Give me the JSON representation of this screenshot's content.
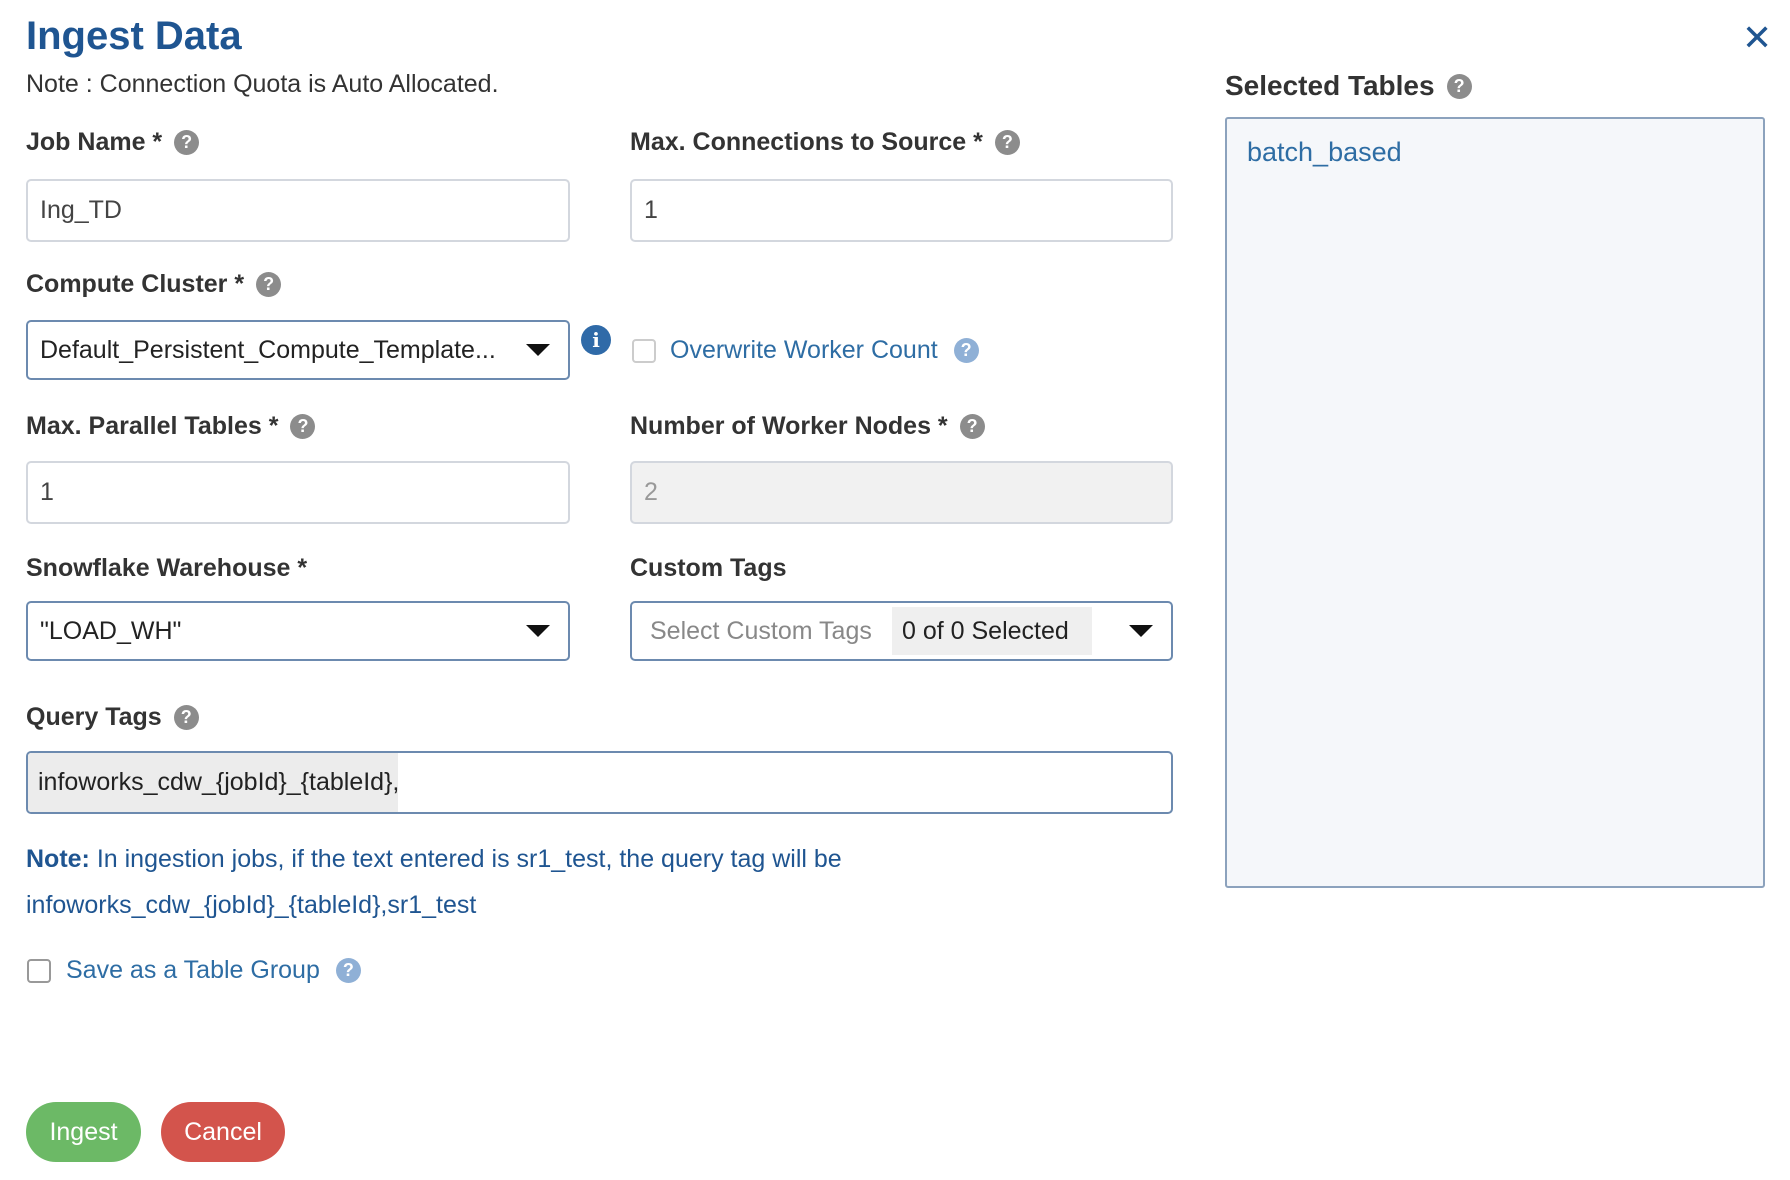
{
  "dialog": {
    "title": "Ingest Data",
    "note_quota": "Note : Connection Quota is Auto Allocated.",
    "close_symbol": "✕"
  },
  "form": {
    "job_name": {
      "label": "Job Name *",
      "value": "Ing_TD"
    },
    "max_connections": {
      "label": "Max. Connections to Source *",
      "value": "1"
    },
    "compute_cluster": {
      "label": "Compute Cluster *",
      "value": "Default_Persistent_Compute_Template..."
    },
    "overwrite_worker_count": {
      "label": "Overwrite Worker Count",
      "checked": false
    },
    "max_parallel_tables": {
      "label": "Max. Parallel Tables *",
      "value": "1"
    },
    "worker_nodes": {
      "label": "Number of Worker Nodes *",
      "value": "2",
      "disabled": true
    },
    "snowflake_warehouse": {
      "label": "Snowflake Warehouse *",
      "value": "\"LOAD_WH\""
    },
    "custom_tags": {
      "label": "Custom Tags",
      "placeholder": "Select Custom Tags",
      "count_text": "0 of 0 Selected"
    },
    "query_tags": {
      "label": "Query Tags",
      "value": "infoworks_cdw_{jobId}_{tableId},"
    },
    "note": {
      "prefix": "Note:",
      "line1": " In ingestion jobs, if the text entered is sr1_test, the query tag will be",
      "line2": "infoworks_cdw_{jobId}_{tableId},sr1_test"
    },
    "save_table_group": {
      "label": "Save as a Table Group",
      "checked": false
    }
  },
  "buttons": {
    "ingest": "Ingest",
    "cancel": "Cancel"
  },
  "selected_tables": {
    "label": "Selected Tables",
    "items": [
      "batch_based"
    ]
  },
  "icons": {
    "help": "question-circle-icon",
    "info": "info-circle-icon",
    "dropdown": "caret-down-icon",
    "close": "close-icon"
  },
  "colors": {
    "title": "#1f5591",
    "link": "#2e6da4",
    "ingest_button": "#6cb966",
    "cancel_button": "#d3544c",
    "select_border": "#6c8aaf"
  }
}
